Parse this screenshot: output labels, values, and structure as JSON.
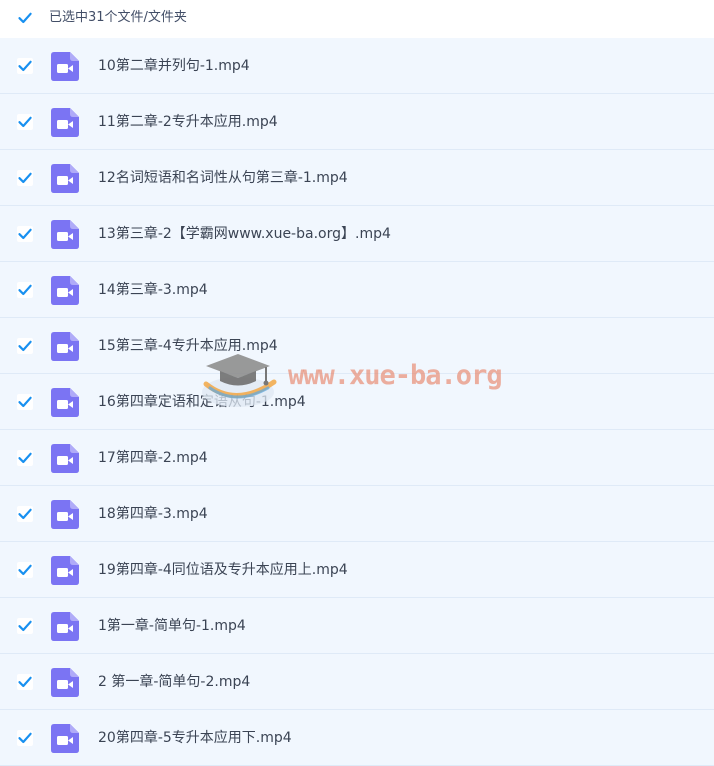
{
  "header": {
    "selection_text": "已选中31个文件/文件夹",
    "checked": true
  },
  "files": [
    {
      "name": "10第二章并列句-1.mp4",
      "checked": true,
      "icon": "video-file-icon"
    },
    {
      "name": "11第二章-2专升本应用.mp4",
      "checked": true,
      "icon": "video-file-icon"
    },
    {
      "name": "12名词短语和名词性从句第三章-1.mp4",
      "checked": true,
      "icon": "video-file-icon"
    },
    {
      "name": "13第三章-2【学霸网www.xue-ba.org】.mp4",
      "checked": true,
      "icon": "video-file-icon"
    },
    {
      "name": "14第三章-3.mp4",
      "checked": true,
      "icon": "video-file-icon"
    },
    {
      "name": "15第三章-4专升本应用.mp4",
      "checked": true,
      "icon": "video-file-icon"
    },
    {
      "name": "16第四章定语和定语从句-1.mp4",
      "checked": true,
      "icon": "video-file-icon"
    },
    {
      "name": "17第四章-2.mp4",
      "checked": true,
      "icon": "video-file-icon"
    },
    {
      "name": "18第四章-3.mp4",
      "checked": true,
      "icon": "video-file-icon"
    },
    {
      "name": "19第四章-4同位语及专升本应用上.mp4",
      "checked": true,
      "icon": "video-file-icon"
    },
    {
      "name": "1第一章-简单句-1.mp4",
      "checked": true,
      "icon": "video-file-icon"
    },
    {
      "name": "2 第一章-简单句-2.mp4",
      "checked": true,
      "icon": "video-file-icon"
    },
    {
      "name": "20第四章-5专升本应用下.mp4",
      "checked": true,
      "icon": "video-file-icon"
    }
  ],
  "watermark": {
    "text": "www.xue-ba.org"
  },
  "colors": {
    "checkbox_check": "#1890f0",
    "row_background": "#f1f7fe",
    "row_divider": "#dfeaf7",
    "video_icon": "#7b74f3",
    "text": "#3b4454",
    "watermark": "#e78062"
  }
}
